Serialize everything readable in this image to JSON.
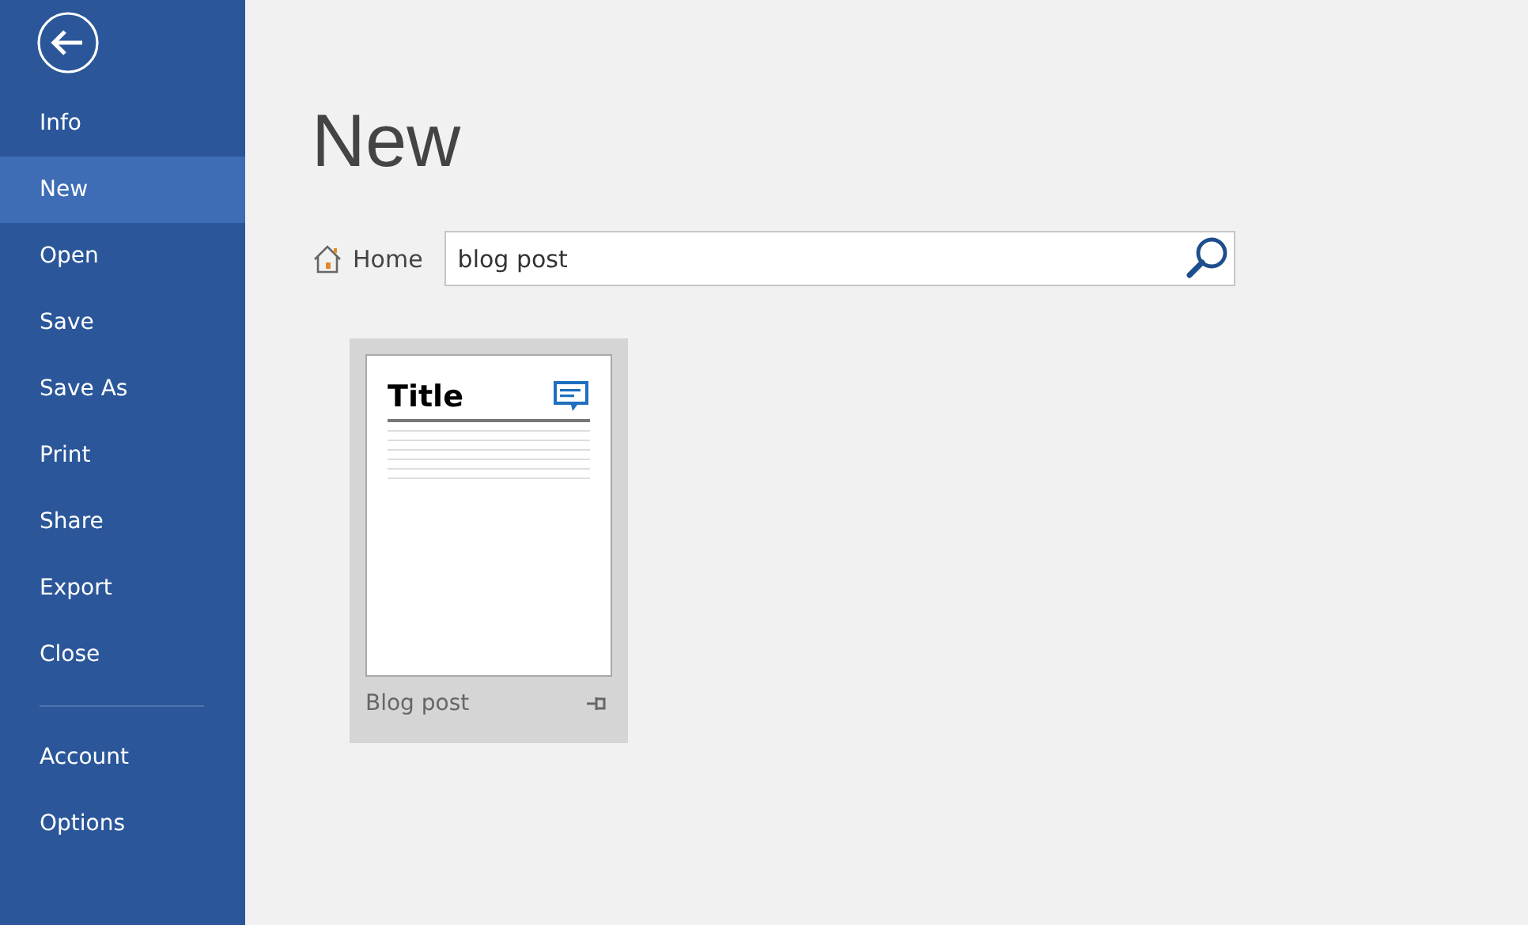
{
  "sidebar": {
    "items": [
      {
        "label": "Info",
        "selected": false
      },
      {
        "label": "New",
        "selected": true
      },
      {
        "label": "Open",
        "selected": false
      },
      {
        "label": "Save",
        "selected": false
      },
      {
        "label": "Save As",
        "selected": false
      },
      {
        "label": "Print",
        "selected": false
      },
      {
        "label": "Share",
        "selected": false
      },
      {
        "label": "Export",
        "selected": false
      },
      {
        "label": "Close",
        "selected": false
      }
    ],
    "footer_items": [
      {
        "label": "Account",
        "selected": false
      },
      {
        "label": "Options",
        "selected": false
      }
    ]
  },
  "page_title": "New",
  "breadcrumb": "Home",
  "search": {
    "value": "blog post"
  },
  "templates": [
    {
      "name": "Blog post",
      "preview_title": "Title",
      "selected": true
    }
  ]
}
